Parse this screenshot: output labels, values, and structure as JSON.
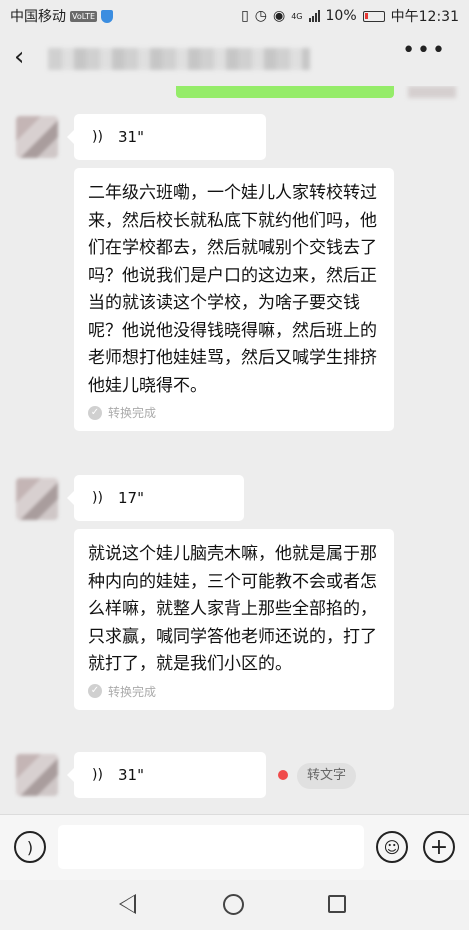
{
  "status_bar": {
    "carrier": "中国移动",
    "volte": "VoLTE",
    "network": "4G",
    "battery": "10%",
    "time": "中午12:31"
  },
  "nav": {
    "back_icon": "chevron-left-icon",
    "more_icon": "more-icon"
  },
  "messages": [
    {
      "type": "voice",
      "duration": "31\"",
      "transcript": "二年级六班嘞，一个娃儿人家转校转过来，然后校长就私底下就约他们吗，他们在学校都去，然后就喊别个交钱去了吗？他说我们是户口的这边来，然后正当的就该读这个学校，为啥子要交钱呢？他说他没得钱晓得嘛，然后班上的老师想打他娃娃骂，然后又喊学生排挤他娃儿晓得不。",
      "status": "转换完成"
    },
    {
      "type": "voice",
      "duration": "17\"",
      "transcript": "就说这个娃儿脑壳木嘛，他就是属于那种内向的娃娃，三个可能教不会或者怎么样嘛，就整人家背上那些全部掐的，只求赢，喊同学答他老师还说的，打了就打了，就是我们小区的。",
      "status": "转换完成"
    },
    {
      "type": "voice",
      "duration": "31\"",
      "action_label": "转文字"
    }
  ],
  "colors": {
    "background": "#ededed",
    "bubble": "#ffffff",
    "self_bubble": "#95ec69",
    "unread_dot": "#f04b4b"
  }
}
